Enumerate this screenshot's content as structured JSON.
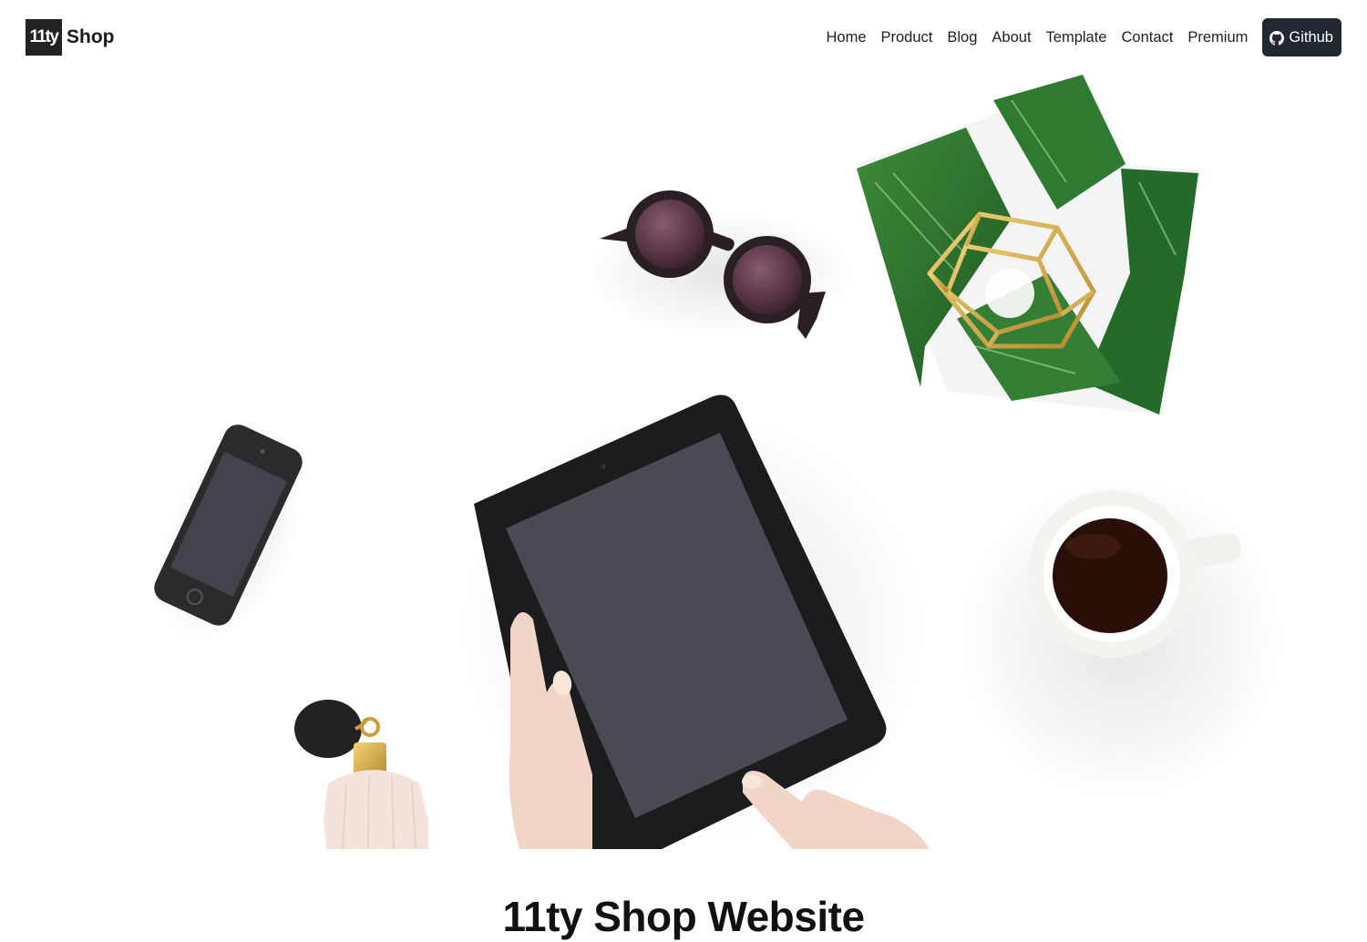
{
  "header": {
    "logo_text": "11ty",
    "brand_name": "Shop",
    "nav": [
      {
        "label": "Home"
      },
      {
        "label": "Product"
      },
      {
        "label": "Blog"
      },
      {
        "label": "About"
      },
      {
        "label": "Template"
      },
      {
        "label": "Contact"
      },
      {
        "label": "Premium"
      }
    ],
    "github_label": "Github",
    "github_icon": "github-icon",
    "github_bg": "#222831"
  },
  "hero": {
    "background": "#ffffff"
  },
  "main": {
    "title": "11ty Shop Website"
  }
}
